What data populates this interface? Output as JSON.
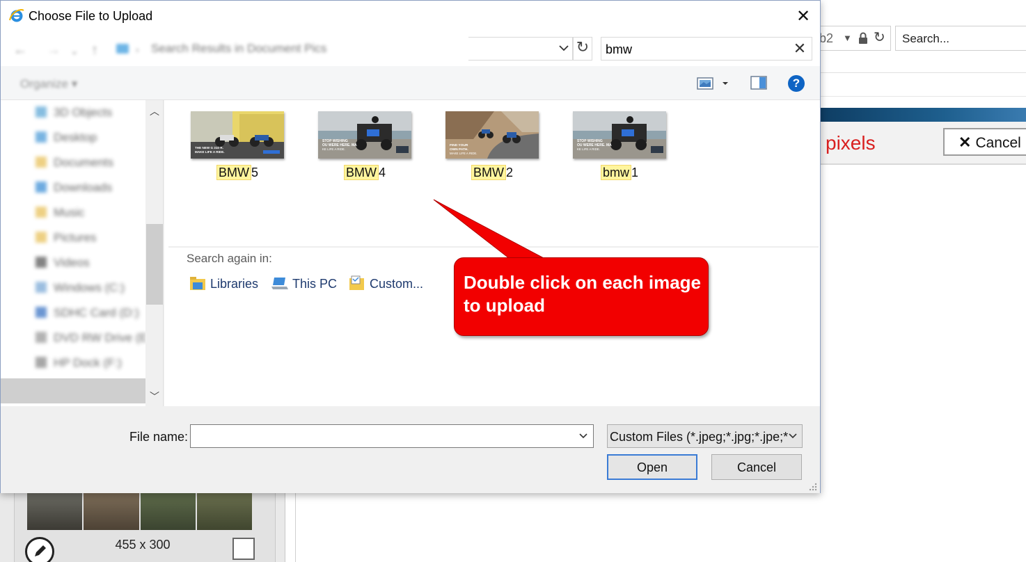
{
  "dialog": {
    "title": "Choose File to Upload",
    "close_glyph": "✕",
    "search_value": "bmw",
    "search_clear_glyph": "✕",
    "refresh_glyph": "↻",
    "help_glyph": "?",
    "breadcrumb": "Search Results in Document Pics",
    "organize_label": "Organize ▾",
    "nav_items": [
      {
        "label": "3D Objects",
        "icon": "folder-3d-icon",
        "color": "#5ea7d6"
      },
      {
        "label": "Desktop",
        "icon": "desktop-folder-icon",
        "color": "#4c9bd8"
      },
      {
        "label": "Documents",
        "icon": "documents-folder-icon",
        "color": "#e8c15a"
      },
      {
        "label": "Downloads",
        "icon": "downloads-folder-icon",
        "color": "#3d8fd6"
      },
      {
        "label": "Music",
        "icon": "music-folder-icon",
        "color": "#e8c15a"
      },
      {
        "label": "Pictures",
        "icon": "pictures-folder-icon",
        "color": "#e8c15a"
      },
      {
        "label": "Videos",
        "icon": "videos-folder-icon",
        "color": "#5a5a5a"
      },
      {
        "label": "Windows (C:)",
        "icon": "drive-icon",
        "color": "#7aa9d6"
      },
      {
        "label": "SDHC Card (D:)",
        "icon": "sd-card-icon",
        "color": "#3b74c4"
      },
      {
        "label": "DVD RW Drive (E:)",
        "icon": "dvd-drive-icon",
        "color": "#9a9a9a"
      },
      {
        "label": "HP Dock (F:)",
        "icon": "dock-drive-icon",
        "color": "#8a8a8a"
      }
    ],
    "files": [
      {
        "match": "BMW",
        "rest": "5",
        "scene": "yellow",
        "caption": "THE NEW G 310 R. MAKE LIFE A RIDE."
      },
      {
        "match": "BMW",
        "rest": "4",
        "scene": "beach",
        "caption": "STOP WISHING YOU WERE HERE. MAKE LIFE A RIDE."
      },
      {
        "match": "BMW",
        "rest": "2",
        "scene": "road",
        "caption": "FIND YOUR OWN PATH. MAKE LIFE A RIDE."
      },
      {
        "match": "bmw",
        "rest": "1",
        "scene": "beach",
        "caption": "STOP WISHING YOU WERE HERE. MAKE LIFE A RIDE."
      }
    ],
    "search_again_label": "Search again in:",
    "search_again_locations": [
      {
        "label": "Libraries",
        "icon": "libraries-icon"
      },
      {
        "label": "This PC",
        "icon": "this-pc-icon"
      },
      {
        "label": "Custom...",
        "icon": "custom-folder-icon"
      }
    ],
    "callout_text": "Double click on each image to upload",
    "file_name_label": "File name:",
    "file_name_value": "",
    "filter_value": "Custom Files (*.jpeg;*.jpg;*.jpe;*",
    "open_label": "Open",
    "cancel_label": "Cancel",
    "accent_color": "#f20000"
  },
  "background_page": {
    "address_fragment": "b2",
    "search_placeholder": "Search...",
    "heading_fragment": "pixels",
    "cancel_label": "Cancel",
    "cancel_glyph": "✕",
    "image_dimensions": "455 x 300"
  }
}
